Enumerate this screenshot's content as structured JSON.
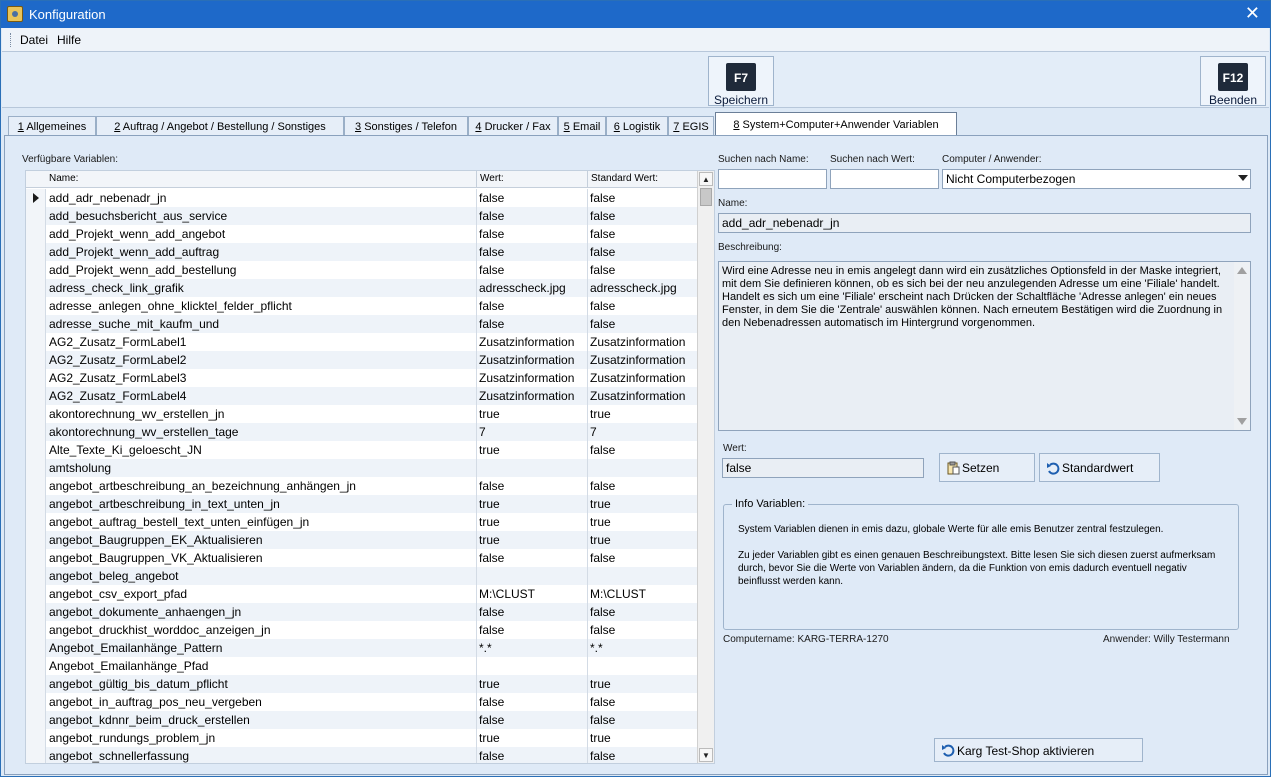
{
  "window": {
    "title": "Konfiguration",
    "close_glyph": "✕"
  },
  "menu": {
    "datei": "Datei",
    "hilfe": "Hilfe"
  },
  "toolbar": {
    "f7_key": "F7",
    "f7_label": "Speichern",
    "f12_key": "F12",
    "f12_label": "Beenden"
  },
  "tabs": [
    {
      "num": "1",
      "label": " Allgemeines"
    },
    {
      "num": "2",
      "label": " Auftrag / Angebot / Bestellung / Sonstiges"
    },
    {
      "num": "3",
      "label": " Sonstiges / Telefon"
    },
    {
      "num": "4",
      "label": " Drucker / Fax"
    },
    {
      "num": "5",
      "label": " Email"
    },
    {
      "num": "6",
      "label": " Logistik"
    },
    {
      "num": "7",
      "label": " EGIS"
    },
    {
      "num": "8",
      "label": " System+Computer+Anwender Variablen"
    }
  ],
  "left": {
    "section_label": "Verfügbare Variablen:",
    "col_name": "Name:",
    "col_wert": "Wert:",
    "col_std": "Standard Wert:",
    "rows": [
      {
        "name": "add_adr_nebenadr_jn",
        "wert": "false",
        "std": "false"
      },
      {
        "name": "add_besuchsbericht_aus_service",
        "wert": "false",
        "std": "false"
      },
      {
        "name": "add_Projekt_wenn_add_angebot",
        "wert": "false",
        "std": "false"
      },
      {
        "name": "add_Projekt_wenn_add_auftrag",
        "wert": "false",
        "std": "false"
      },
      {
        "name": "add_Projekt_wenn_add_bestellung",
        "wert": "false",
        "std": "false"
      },
      {
        "name": "adress_check_link_grafik",
        "wert": "adresscheck.jpg",
        "std": "adresscheck.jpg"
      },
      {
        "name": "adresse_anlegen_ohne_klicktel_felder_pflicht",
        "wert": "false",
        "std": "false"
      },
      {
        "name": "adresse_suche_mit_kaufm_und",
        "wert": "false",
        "std": "false"
      },
      {
        "name": "AG2_Zusatz_FormLabel1",
        "wert": "Zusatzinformation",
        "std": "Zusatzinformation"
      },
      {
        "name": "AG2_Zusatz_FormLabel2",
        "wert": "Zusatzinformation",
        "std": "Zusatzinformation"
      },
      {
        "name": "AG2_Zusatz_FormLabel3",
        "wert": "Zusatzinformation",
        "std": "Zusatzinformation"
      },
      {
        "name": "AG2_Zusatz_FormLabel4",
        "wert": "Zusatzinformation",
        "std": "Zusatzinformation"
      },
      {
        "name": "akontorechnung_wv_erstellen_jn",
        "wert": "true",
        "std": "true"
      },
      {
        "name": "akontorechnung_wv_erstellen_tage",
        "wert": "7",
        "std": "7"
      },
      {
        "name": "Alte_Texte_Ki_geloescht_JN",
        "wert": "true",
        "std": "false"
      },
      {
        "name": "amtsholung",
        "wert": "",
        "std": ""
      },
      {
        "name": "angebot_artbeschreibung_an_bezeichnung_anhängen_jn",
        "wert": "false",
        "std": "false"
      },
      {
        "name": "angebot_artbeschreibung_in_text_unten_jn",
        "wert": "true",
        "std": "true"
      },
      {
        "name": "angebot_auftrag_bestell_text_unten_einfügen_jn",
        "wert": "true",
        "std": "true"
      },
      {
        "name": "angebot_Baugruppen_EK_Aktualisieren",
        "wert": "true",
        "std": "true"
      },
      {
        "name": "angebot_Baugruppen_VK_Aktualisieren",
        "wert": "false",
        "std": "false"
      },
      {
        "name": "angebot_beleg_angebot",
        "wert": "",
        "std": ""
      },
      {
        "name": "angebot_csv_export_pfad",
        "wert": "M:\\CLUST",
        "std": "M:\\CLUST"
      },
      {
        "name": "angebot_dokumente_anhaengen_jn",
        "wert": "false",
        "std": "false"
      },
      {
        "name": "angebot_druckhist_worddoc_anzeigen_jn",
        "wert": "false",
        "std": "false"
      },
      {
        "name": "Angebot_Emailanhänge_Pattern",
        "wert": "*.*",
        "std": "*.*"
      },
      {
        "name": "Angebot_Emailanhänge_Pfad",
        "wert": "",
        "std": ""
      },
      {
        "name": "angebot_gültig_bis_datum_pflicht",
        "wert": "true",
        "std": "true"
      },
      {
        "name": "angebot_in_auftrag_pos_neu_vergeben",
        "wert": "false",
        "std": "false"
      },
      {
        "name": "angebot_kdnnr_beim_druck_erstellen",
        "wert": "false",
        "std": "false"
      },
      {
        "name": "angebot_rundungs_problem_jn",
        "wert": "true",
        "std": "true"
      },
      {
        "name": "angebot_schnellerfassung",
        "wert": "false",
        "std": "false"
      }
    ]
  },
  "right": {
    "search_name_label": "Suchen nach Name:",
    "search_wert_label": "Suchen nach Wert:",
    "computer_label": "Computer / Anwender:",
    "computer_value": "Nicht Computerbezogen",
    "name_label": "Name:",
    "name_value": "add_adr_nebenadr_jn",
    "beschreibung_label": "Beschreibung:",
    "beschreibung": "Wird eine Adresse neu in emis angelegt dann wird ein zusätzliches Optionsfeld in der Maske integriert, mit dem Sie definieren können, ob es sich bei der neu anzulegenden Adresse um eine 'Filiale' handelt. Handelt es sich um eine 'Filiale' erscheint nach Drücken der Schaltfläche 'Adresse anlegen' ein neues Fenster, in dem Sie die 'Zentrale' auswählen können. Nach erneutem Bestätigen wird die Zuordnung in den Nebenadressen automatisch im Hintergrund vorgenommen.",
    "wert_label": "Wert:",
    "wert_value": "false",
    "setzen_label": "Setzen",
    "standard_label": "Standardwert",
    "info_legend": "Info Variablen:",
    "info_p1": "System Variablen dienen in emis dazu, globale Werte für alle emis Benutzer zentral festzulegen.",
    "info_p2": "Zu jeder Variablen gibt es einen genauen Beschreibungstext. Bitte lesen Sie sich diesen zuerst aufmerksam durch, bevor Sie die Werte von Variablen ändern, da die Funktion von emis dadurch eventuell negativ beinflusst werden kann.",
    "computername": "Computername: KARG-TERRA-1270",
    "anwender": "Anwender: Willy Testermann",
    "testshop_label": "Karg Test-Shop aktivieren"
  }
}
